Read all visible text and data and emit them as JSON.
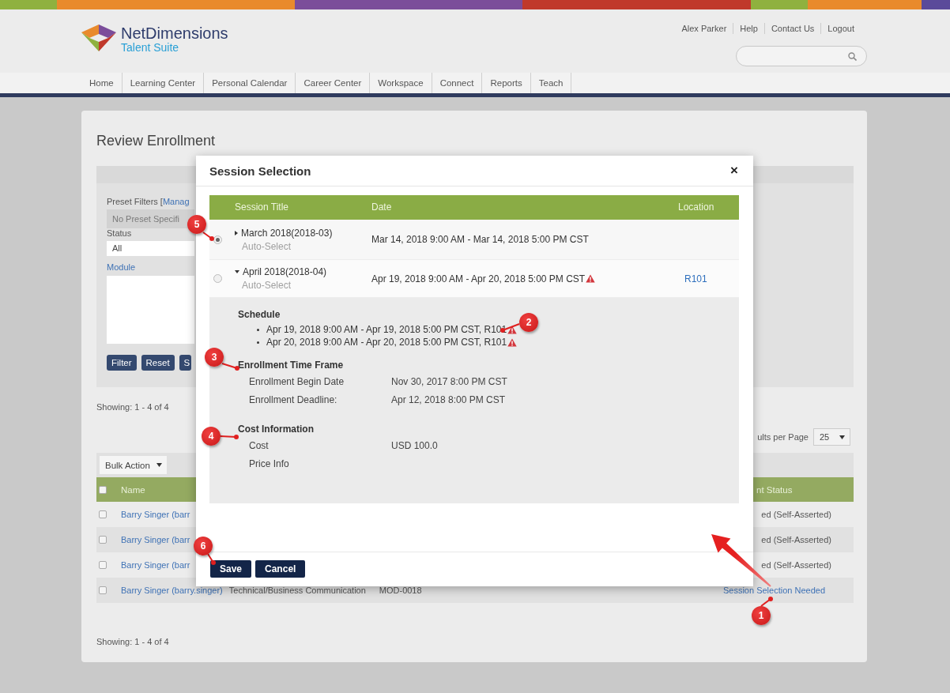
{
  "header": {
    "logo_name": "NetDimensions",
    "logo_tagline": "Talent Suite",
    "user_links": [
      "Alex Parker",
      "Help",
      "Contact Us",
      "Logout"
    ],
    "nav": [
      "Home",
      "Learning Center",
      "Personal Calendar",
      "Career Center",
      "Workspace",
      "Connect",
      "Reports",
      "Teach"
    ]
  },
  "page": {
    "title": "Review Enrollment",
    "filters": {
      "preset_label": "Preset Filters [",
      "manage_link": "Manag",
      "preset_value": "No Preset Specifi",
      "status_label": "Status",
      "status_value": "All",
      "module_label": "Module",
      "buttons": [
        "Filter",
        "Reset",
        "S"
      ]
    },
    "showing_top": "Showing: 1 - 4 of 4",
    "results_per_page_label": "ults per Page",
    "results_per_page": "25",
    "bulk_action": "Bulk Action",
    "table": {
      "columns": [
        "Name",
        "nt Status"
      ],
      "header_checked": false,
      "rows": [
        {
          "checked": false,
          "name": "Barry Singer (barr",
          "status": "ed (Self-Asserted)",
          "kind": "text"
        },
        {
          "checked": false,
          "name": "Barry Singer (barr",
          "status": "ed (Self-Asserted)",
          "kind": "text"
        },
        {
          "checked": false,
          "name": "Barry Singer (barr",
          "status": "ed (Self-Asserted)",
          "kind": "text"
        },
        {
          "checked": false,
          "name": "Barry Singer (barry.singer)",
          "course": "Technical/Business Communication",
          "module": "MOD-0018",
          "status": "Session Selection Needed",
          "kind": "link"
        }
      ]
    },
    "showing_bottom": "Showing: 1 - 4 of 4"
  },
  "modal": {
    "title": "Session Selection",
    "close": "×",
    "columns": [
      "Session Title",
      "Date",
      "Location"
    ],
    "sessions": [
      {
        "title": "March 2018(2018-03)",
        "subtitle": "Auto-Select",
        "date": "Mar 14, 2018 9:00 AM - Mar 14, 2018 5:00 PM CST",
        "selected": true,
        "expanded": false,
        "warning": false
      },
      {
        "title": "April 2018(2018-04)",
        "subtitle": "Auto-Select",
        "date": "Apr 19, 2018 9:00 AM - Apr 20, 2018 5:00 PM CST",
        "location": "R101",
        "selected": false,
        "expanded": true,
        "warning": true
      }
    ],
    "details": {
      "schedule_heading": "Schedule",
      "schedule": [
        {
          "text": "Apr 19, 2018 9:00 AM - Apr 19, 2018 5:00 PM CST, R101",
          "warning": true
        },
        {
          "text": "Apr 20, 2018 9:00 AM - Apr 20, 2018 5:00 PM CST, R101",
          "warning": true
        }
      ],
      "sections": [
        {
          "heading": "Enrollment Time Frame",
          "rows": [
            {
              "label": "Enrollment Begin Date",
              "value": "Nov 30, 2017 8:00 PM CST"
            },
            {
              "label": "Enrollment Deadline:",
              "value": "Apr 12, 2018 8:00 PM CST"
            }
          ]
        },
        {
          "heading": "Cost Information",
          "rows": [
            {
              "label": "Cost",
              "value": "USD 100.0"
            },
            {
              "label": "Price Info"
            }
          ]
        }
      ]
    },
    "buttons": [
      "Save",
      "Cancel"
    ]
  },
  "callouts": [
    "1",
    "2",
    "3",
    "4",
    "5",
    "6"
  ]
}
